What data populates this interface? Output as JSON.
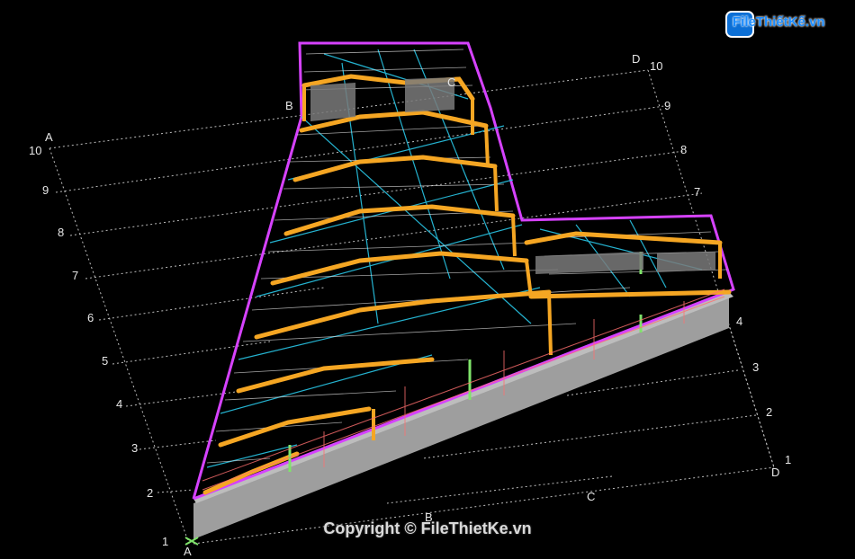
{
  "watermark": {
    "logo_text": "FileThiếtKế.vn",
    "copyright": "Copyright © FileThietKe.vn"
  },
  "axes_left_letter_top": "A",
  "axes_left_letter_bottom": "A",
  "axis_b_top": "B",
  "axis_c_top": "C",
  "axis_d_top": "D",
  "axis_b_bottom": "B",
  "axis_c_bottom": "C",
  "axis_d_bottom": "D",
  "left_numbers": [
    "10",
    "9",
    "8",
    "7",
    "6",
    "5",
    "4",
    "3",
    "2",
    "1"
  ],
  "right_numbers": [
    "10",
    "9",
    "8",
    "7",
    "4",
    "3",
    "2",
    "1"
  ],
  "colors": {
    "background": "#000000",
    "frame": "#f5a623",
    "purlin": "#e6e6e6",
    "bracing": "#29c6e6",
    "edge": "#d642ff",
    "column": "#7fe36a",
    "wall": "#9e9e9e",
    "grid": "#bdbdbd"
  }
}
